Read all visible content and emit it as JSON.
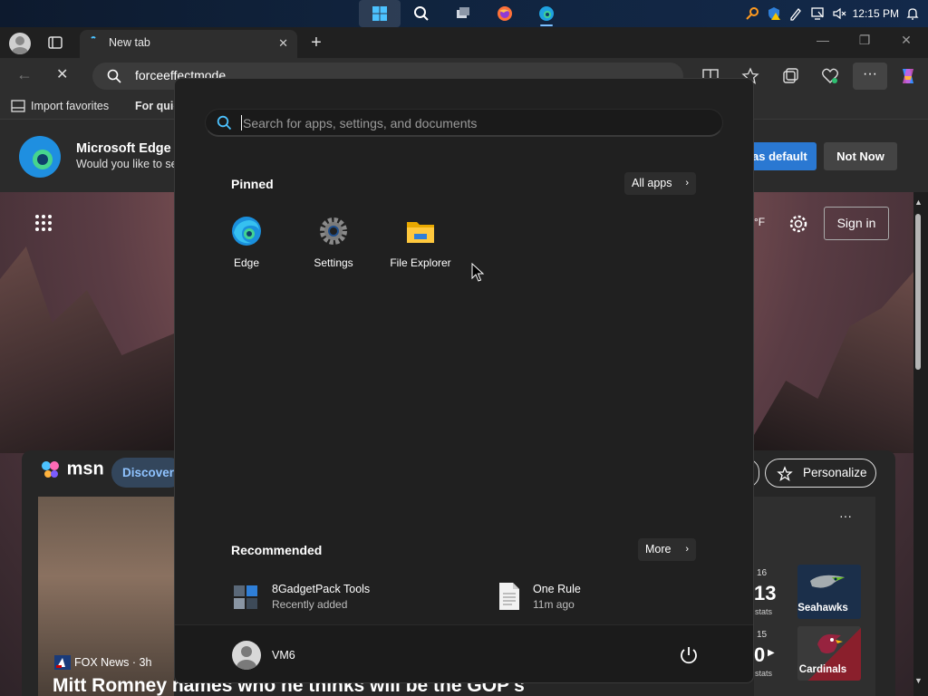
{
  "taskbar": {
    "time": "12:15 PM",
    "apps": [
      "start-icon",
      "search-icon",
      "task-view-icon",
      "firefox-icon",
      "edge-icon"
    ]
  },
  "browser": {
    "tab_title": "New tab",
    "address": "forceeffectmode",
    "bookmarks": [
      "Import favorites",
      "For quic"
    ]
  },
  "banner": {
    "title": "Microsoft Edge",
    "subtitle": "Would you like to se",
    "default_btn": "as default",
    "not_now_btn": "Not Now"
  },
  "newtab": {
    "temp_unit": "°F",
    "sign_in": "Sign in",
    "msn": "msn",
    "discover": "Discover",
    "personalize": "Personalize",
    "news_source": "FOX News · 3h",
    "headline": "Mitt Romney names who he thinks will be the GOP's",
    "sports": [
      {
        "week": "16",
        "score": "13",
        "stats": "stats",
        "team": "Seahawks",
        "color": "#1b2f4a"
      },
      {
        "week": "15",
        "score": "0",
        "stats": "stats",
        "team": "Cardinals",
        "color": "#8a1f2c"
      }
    ]
  },
  "start_menu": {
    "search_placeholder": "Search for apps, settings, and documents",
    "pinned_title": "Pinned",
    "all_apps": "All apps",
    "pinned": [
      {
        "label": "Edge",
        "icon": "edge-icon"
      },
      {
        "label": "Settings",
        "icon": "settings-gear-icon"
      },
      {
        "label": "File Explorer",
        "icon": "folder-icon"
      }
    ],
    "recommended_title": "Recommended",
    "more": "More",
    "recommended": [
      {
        "title": "8GadgetPack Tools",
        "subtitle": "Recently added",
        "icon": "gadgetpack-icon"
      },
      {
        "title": "One Rule",
        "subtitle": "11m ago",
        "icon": "document-icon"
      }
    ],
    "user": "VM6"
  }
}
